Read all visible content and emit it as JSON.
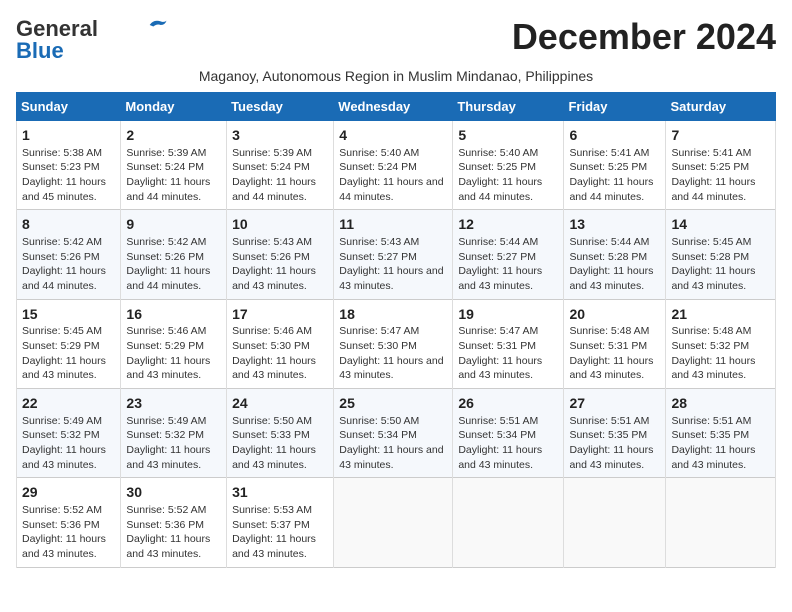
{
  "logo": {
    "line1": "General",
    "line2": "Blue"
  },
  "title": "December 2024",
  "subtitle": "Maganoy, Autonomous Region in Muslim Mindanao, Philippines",
  "days_of_week": [
    "Sunday",
    "Monday",
    "Tuesday",
    "Wednesday",
    "Thursday",
    "Friday",
    "Saturday"
  ],
  "weeks": [
    [
      {
        "day": 1,
        "sunrise": "5:38 AM",
        "sunset": "5:23 PM",
        "daylight": "11 hours and 45 minutes."
      },
      {
        "day": 2,
        "sunrise": "5:39 AM",
        "sunset": "5:24 PM",
        "daylight": "11 hours and 44 minutes."
      },
      {
        "day": 3,
        "sunrise": "5:39 AM",
        "sunset": "5:24 PM",
        "daylight": "11 hours and 44 minutes."
      },
      {
        "day": 4,
        "sunrise": "5:40 AM",
        "sunset": "5:24 PM",
        "daylight": "11 hours and 44 minutes."
      },
      {
        "day": 5,
        "sunrise": "5:40 AM",
        "sunset": "5:25 PM",
        "daylight": "11 hours and 44 minutes."
      },
      {
        "day": 6,
        "sunrise": "5:41 AM",
        "sunset": "5:25 PM",
        "daylight": "11 hours and 44 minutes."
      },
      {
        "day": 7,
        "sunrise": "5:41 AM",
        "sunset": "5:25 PM",
        "daylight": "11 hours and 44 minutes."
      }
    ],
    [
      {
        "day": 8,
        "sunrise": "5:42 AM",
        "sunset": "5:26 PM",
        "daylight": "11 hours and 44 minutes."
      },
      {
        "day": 9,
        "sunrise": "5:42 AM",
        "sunset": "5:26 PM",
        "daylight": "11 hours and 44 minutes."
      },
      {
        "day": 10,
        "sunrise": "5:43 AM",
        "sunset": "5:26 PM",
        "daylight": "11 hours and 43 minutes."
      },
      {
        "day": 11,
        "sunrise": "5:43 AM",
        "sunset": "5:27 PM",
        "daylight": "11 hours and 43 minutes."
      },
      {
        "day": 12,
        "sunrise": "5:44 AM",
        "sunset": "5:27 PM",
        "daylight": "11 hours and 43 minutes."
      },
      {
        "day": 13,
        "sunrise": "5:44 AM",
        "sunset": "5:28 PM",
        "daylight": "11 hours and 43 minutes."
      },
      {
        "day": 14,
        "sunrise": "5:45 AM",
        "sunset": "5:28 PM",
        "daylight": "11 hours and 43 minutes."
      }
    ],
    [
      {
        "day": 15,
        "sunrise": "5:45 AM",
        "sunset": "5:29 PM",
        "daylight": "11 hours and 43 minutes."
      },
      {
        "day": 16,
        "sunrise": "5:46 AM",
        "sunset": "5:29 PM",
        "daylight": "11 hours and 43 minutes."
      },
      {
        "day": 17,
        "sunrise": "5:46 AM",
        "sunset": "5:30 PM",
        "daylight": "11 hours and 43 minutes."
      },
      {
        "day": 18,
        "sunrise": "5:47 AM",
        "sunset": "5:30 PM",
        "daylight": "11 hours and 43 minutes."
      },
      {
        "day": 19,
        "sunrise": "5:47 AM",
        "sunset": "5:31 PM",
        "daylight": "11 hours and 43 minutes."
      },
      {
        "day": 20,
        "sunrise": "5:48 AM",
        "sunset": "5:31 PM",
        "daylight": "11 hours and 43 minutes."
      },
      {
        "day": 21,
        "sunrise": "5:48 AM",
        "sunset": "5:32 PM",
        "daylight": "11 hours and 43 minutes."
      }
    ],
    [
      {
        "day": 22,
        "sunrise": "5:49 AM",
        "sunset": "5:32 PM",
        "daylight": "11 hours and 43 minutes."
      },
      {
        "day": 23,
        "sunrise": "5:49 AM",
        "sunset": "5:32 PM",
        "daylight": "11 hours and 43 minutes."
      },
      {
        "day": 24,
        "sunrise": "5:50 AM",
        "sunset": "5:33 PM",
        "daylight": "11 hours and 43 minutes."
      },
      {
        "day": 25,
        "sunrise": "5:50 AM",
        "sunset": "5:34 PM",
        "daylight": "11 hours and 43 minutes."
      },
      {
        "day": 26,
        "sunrise": "5:51 AM",
        "sunset": "5:34 PM",
        "daylight": "11 hours and 43 minutes."
      },
      {
        "day": 27,
        "sunrise": "5:51 AM",
        "sunset": "5:35 PM",
        "daylight": "11 hours and 43 minutes."
      },
      {
        "day": 28,
        "sunrise": "5:51 AM",
        "sunset": "5:35 PM",
        "daylight": "11 hours and 43 minutes."
      }
    ],
    [
      {
        "day": 29,
        "sunrise": "5:52 AM",
        "sunset": "5:36 PM",
        "daylight": "11 hours and 43 minutes."
      },
      {
        "day": 30,
        "sunrise": "5:52 AM",
        "sunset": "5:36 PM",
        "daylight": "11 hours and 43 minutes."
      },
      {
        "day": 31,
        "sunrise": "5:53 AM",
        "sunset": "5:37 PM",
        "daylight": "11 hours and 43 minutes."
      },
      null,
      null,
      null,
      null
    ]
  ],
  "labels": {
    "sunrise": "Sunrise:",
    "sunset": "Sunset:",
    "daylight": "Daylight:"
  }
}
